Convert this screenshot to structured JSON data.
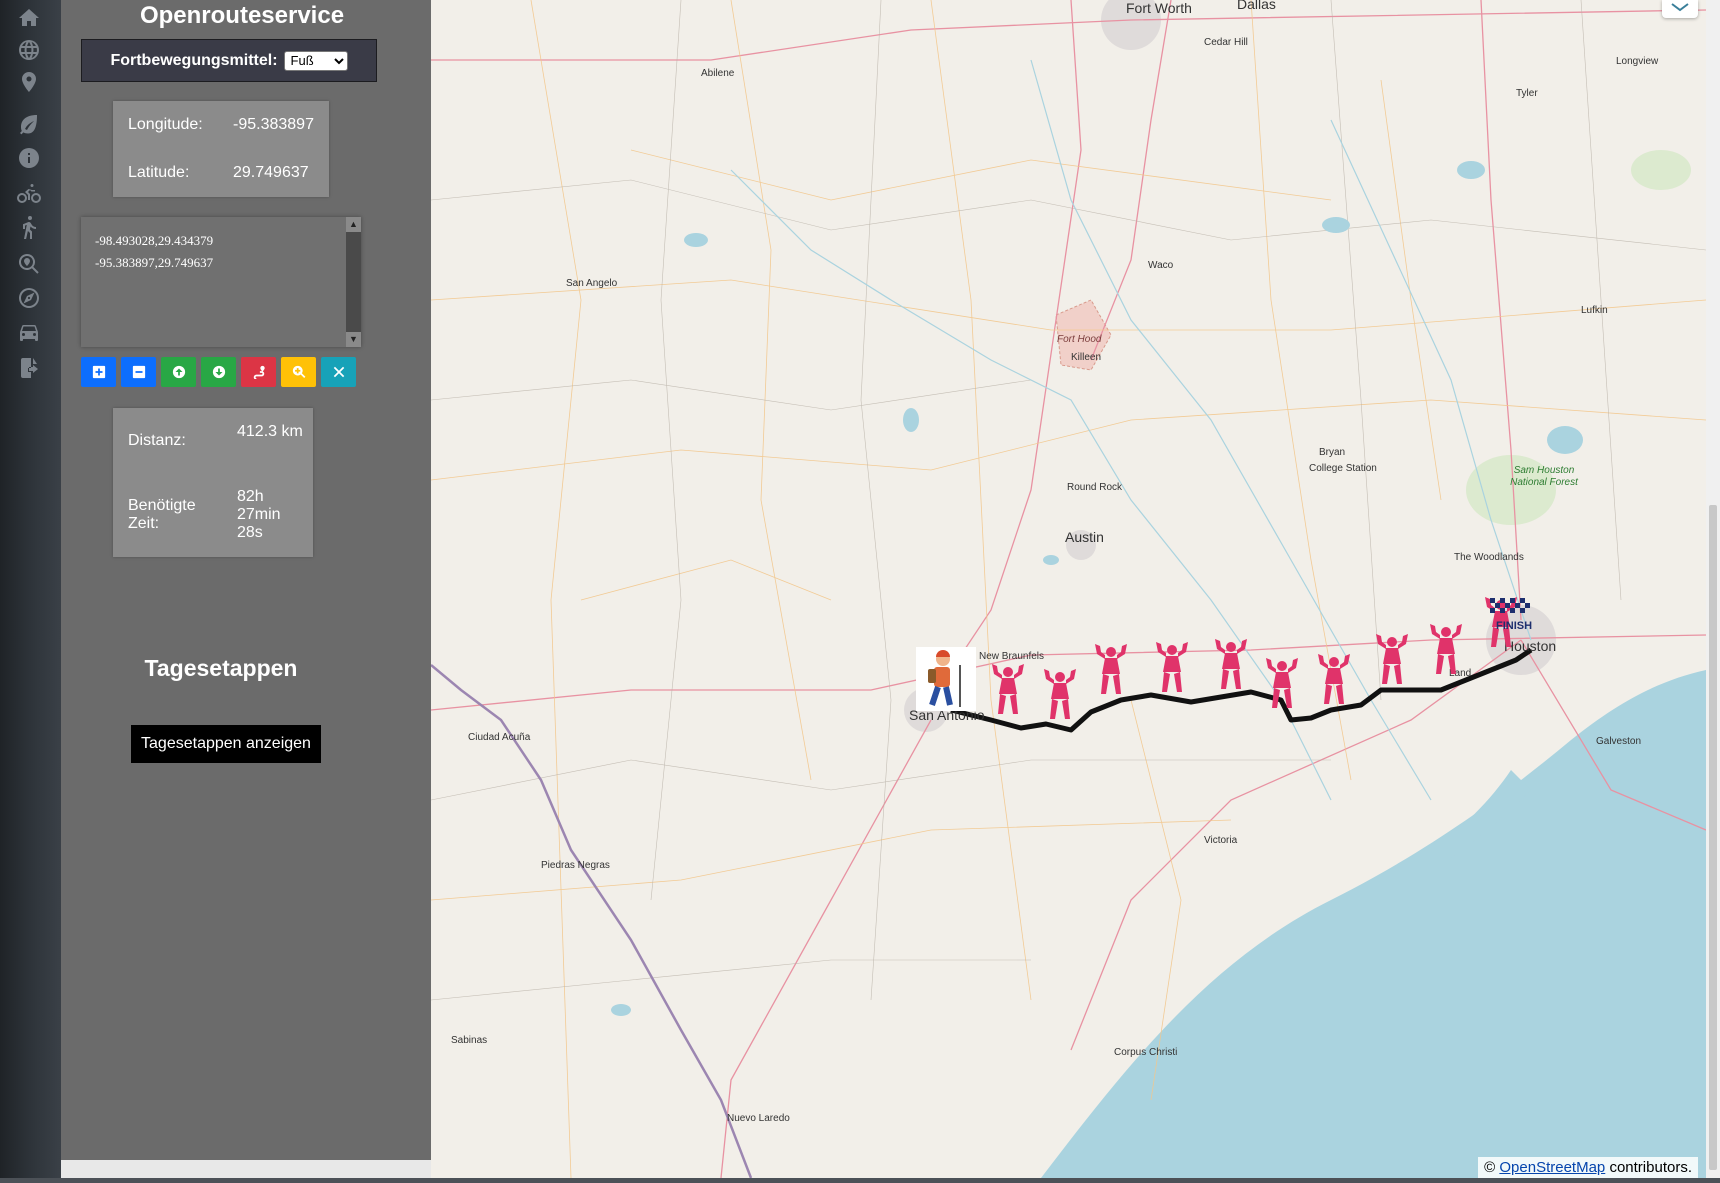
{
  "sidebar": {
    "icons": [
      "home-icon",
      "globe-icon",
      "map-pin-icon",
      "leaf-icon",
      "info-icon",
      "bicycle-icon",
      "hiker-icon",
      "search-location-icon",
      "compass-icon",
      "car-icon",
      "export-icon"
    ]
  },
  "panel": {
    "title": "Openrouteservice",
    "transport_label": "Fortbewegungsmittel:",
    "transport_selected": "Fuß",
    "longitude_label": "Longitude:",
    "longitude_value": "-95.383897",
    "latitude_label": "Latitude:",
    "latitude_value": "29.749637",
    "coordinates_text": "-98.493028,29.434379\n-95.383897,29.749637",
    "tool_buttons": [
      {
        "name": "add-point-button",
        "icon": "plus-square-icon",
        "color": "#0d6efd"
      },
      {
        "name": "remove-point-button",
        "icon": "minus-square-icon",
        "color": "#0d6efd"
      },
      {
        "name": "move-up-button",
        "icon": "arrow-circle-up-icon",
        "color": "#28a745"
      },
      {
        "name": "move-down-button",
        "icon": "arrow-circle-down-icon",
        "color": "#28a745"
      },
      {
        "name": "route-button",
        "icon": "route-icon",
        "color": "#dc3545"
      },
      {
        "name": "zoom-button",
        "icon": "zoom-in-icon",
        "color": "#ffc107"
      },
      {
        "name": "clear-button",
        "icon": "times-icon",
        "color": "#17a2b8"
      }
    ],
    "distance_label": "Distanz:",
    "distance_value": "412.3 km",
    "time_label": "Benötigte Zeit:",
    "time_value": "82h 27min 28s",
    "stages_title": "Tagesetappen",
    "stages_button": "Tagesetappen anzeigen"
  },
  "map": {
    "labels": [
      {
        "text": "Fort Worth",
        "big": true
      },
      {
        "text": "Dallas",
        "big": true
      },
      {
        "text": "Cedar Hill"
      },
      {
        "text": "Abilene"
      },
      {
        "text": "Longview"
      },
      {
        "text": "Tyler"
      },
      {
        "text": "Waco"
      },
      {
        "text": "San Angelo"
      },
      {
        "text": "Lufkin"
      },
      {
        "text": "Fort Hood"
      },
      {
        "text": "Killeen"
      },
      {
        "text": "Bryan"
      },
      {
        "text": "College Station"
      },
      {
        "text": "Sam Houston National Forest"
      },
      {
        "text": "Round Rock"
      },
      {
        "text": "Austin",
        "big": true
      },
      {
        "text": "The Woodlands"
      },
      {
        "text": "New Braunfels"
      },
      {
        "text": "San Antonio",
        "big": true
      },
      {
        "text": "Houston",
        "big": true
      },
      {
        "text": "Land"
      },
      {
        "text": "Ciudad Acuña"
      },
      {
        "text": "Galveston"
      },
      {
        "text": "Victoria"
      },
      {
        "text": "Piedras Negras"
      },
      {
        "text": "Sabinas"
      },
      {
        "text": "Corpus Christi"
      },
      {
        "text": "Nuevo Laredo"
      }
    ],
    "start_marker_icon": "hiker-icon",
    "stage_marker_icon": "flexing-person-icon",
    "finish_marker_icon": "finish-flag-icon",
    "finish_marker_text": "FINISH",
    "attribution_prefix": "©",
    "attribution_link": "OpenStreetMap",
    "attribution_suffix": "contributors."
  }
}
